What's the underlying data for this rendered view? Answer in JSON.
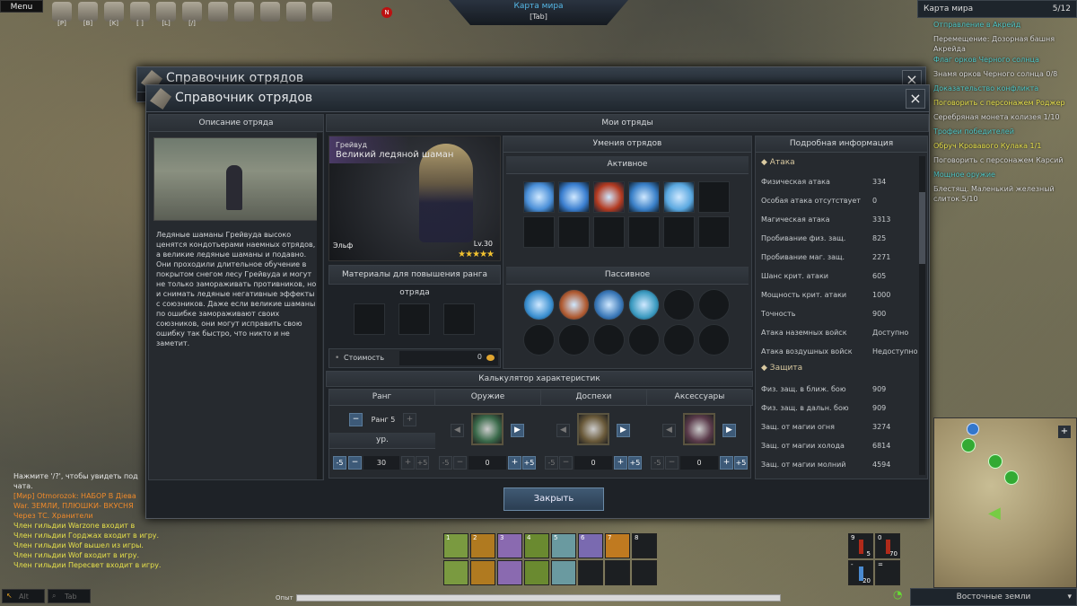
{
  "hud": {
    "menu": "Menu",
    "top_keys": [
      "[P]",
      "[B]",
      "[K]",
      "[ ]",
      "[L]",
      "[/]"
    ],
    "notif_badge": "N",
    "map_banner": {
      "title": "Карта мира",
      "key": "[Tab]"
    }
  },
  "quest_tracker": {
    "title": "Карта мира",
    "count": "5/12",
    "items": [
      {
        "text": "Отправление в Акрейд",
        "color": "#4fc7c7"
      },
      {
        "text": "Перемещение: Дозорная башня Акрейда",
        "color": "#d8d8d8"
      },
      {
        "text": "Флаг орков Черного солнца",
        "color": "#4fc7c7"
      },
      {
        "text": "Знамя орков Черного солнца 0/8",
        "color": "#d8d8d8"
      },
      {
        "text": "Доказательство конфликта",
        "color": "#4fc7c7"
      },
      {
        "text": "Поговорить с персонажем Роджер",
        "color": "#e6e04a"
      },
      {
        "text": "Серебряная монета колизея 1/10",
        "color": "#d8d8d8"
      },
      {
        "text": "Трофеи победителей",
        "color": "#4fc7c7"
      },
      {
        "text": "Обруч Кровавого Кулака 1/1",
        "color": "#e6e04a"
      },
      {
        "text": "Поговорить с персонажем Карсий",
        "color": "#d8d8d8"
      },
      {
        "text": "Мощное оружие",
        "color": "#4fc7c7"
      },
      {
        "text": "Блестящ. Маленький железный слиток 5/10",
        "color": "#d8d8d8"
      }
    ]
  },
  "chat": [
    {
      "text": "Нажмите '/?', чтобы увидеть под",
      "color": "#e8e8e8"
    },
    {
      "text": "чата.",
      "color": "#e8e8e8"
    },
    {
      "text": "[Мир] Otmorozok: НАБОР В Дiева",
      "color": "#f08a2a"
    },
    {
      "text": "War. ЗЕМЛИ, ПЛЮШКИ- ВКУСНЯ",
      "color": "#f08a2a"
    },
    {
      "text": "Через ТС. Хранители",
      "color": "#f08a2a"
    },
    {
      "text": "Член гильдии Warzone входит в",
      "color": "#e6e04a"
    },
    {
      "text": "Член гильдии Горджах входит в игру.",
      "color": "#e6e04a"
    },
    {
      "text": "Член гильдии Wof вышел из игры.",
      "color": "#e6e04a"
    },
    {
      "text": "Член гильдии Wof входит в игру.",
      "color": "#e6e04a"
    },
    {
      "text": "Член гильдии Пересвет входит в игру.",
      "color": "#e6e04a"
    }
  ],
  "chat_keys": [
    "Alt",
    "Tab"
  ],
  "window_back": {
    "title": "Справочник отрядов"
  },
  "window": {
    "title": "Справочник отрядов",
    "close_icon": "×",
    "description": {
      "header": "Описание отряда",
      "text": "Ледяные шаманы Грейвуда высоко ценятся кондотьерами наемных отрядов, а великие ледяные шаманы и подавно. Они проходили длительное обучение в покрытом снегом лесу Грейвуда и могут не только замораживать противников, но и снимать ледяные негативные эффекты с союзников. Даже если великие шаманы по ошибке замораживают своих союзников, они могут исправить свою ошибку так быстро, что никто и не заметит."
    },
    "my_units": {
      "header": "Мои отряды"
    },
    "unit": {
      "faction": "Грейвуд",
      "name": "Великий ледяной шаман",
      "race": "Эльф",
      "level": "Lv.30",
      "stars": 5
    },
    "materials": {
      "header": "Материалы для повышения ранга отряда",
      "cost_label": "Стоимость",
      "cost_value": "0"
    },
    "skills": {
      "header": "Умения отрядов",
      "active_header": "Активное",
      "passive_header": "Пассивное",
      "active_filled": 5,
      "passive_filled": 4
    },
    "calculator": {
      "header": "Калькулятор характеристик",
      "rank": {
        "label": "Ранг",
        "value": "Ранг 5",
        "level_label": "ур.",
        "level": "30"
      },
      "columns": [
        {
          "label": "Оружие",
          "value": "0",
          "icon": "staff-icon"
        },
        {
          "label": "Доспехи",
          "value": "0",
          "icon": "armor-icon"
        },
        {
          "label": "Аксессуары",
          "value": "0",
          "icon": "ring-icon"
        }
      ],
      "minus5": "-5",
      "plus5": "+5",
      "minus": "−",
      "plus": "+"
    },
    "details": {
      "header": "Подробная информация",
      "attack_header": "Атака",
      "attack": [
        [
          "Физическая атака",
          "334"
        ],
        [
          "Особая атака отсутствует",
          "0"
        ],
        [
          "Магическая атака",
          "3313"
        ],
        [
          "Пробивание физ. защ.",
          "825"
        ],
        [
          "Пробивание маг. защ.",
          "2271"
        ],
        [
          "Шанс крит. атаки",
          "605"
        ],
        [
          "Мощность крит. атаки",
          "1000"
        ],
        [
          "Точность",
          "900"
        ],
        [
          "Атака наземных войск",
          "Доступно"
        ],
        [
          "Атака воздушных войск",
          "Недоступно"
        ]
      ],
      "defense_header": "Защита",
      "defense": [
        [
          "Физ. защ. в ближ. бою",
          "909"
        ],
        [
          "Физ. защ. в дальн. бою",
          "909"
        ],
        [
          "Защ. от магии огня",
          "3274"
        ],
        [
          "Защ. от магии холода",
          "6814"
        ],
        [
          "Защ. от магии молний",
          "4594"
        ]
      ]
    },
    "close_button": "Закрыть"
  },
  "hotbar": {
    "keys": [
      "1",
      "2",
      "3",
      "4",
      "5",
      "6",
      "7",
      "8"
    ],
    "potions": [
      {
        "key": "9",
        "count": "5"
      },
      {
        "key": "0",
        "count": "70"
      },
      {
        "key": "-",
        "count": "20"
      },
      {
        "key": "=",
        "count": ""
      }
    ]
  },
  "exp_label": "Опыт",
  "minimap": {
    "zone": "Восточные земли"
  }
}
